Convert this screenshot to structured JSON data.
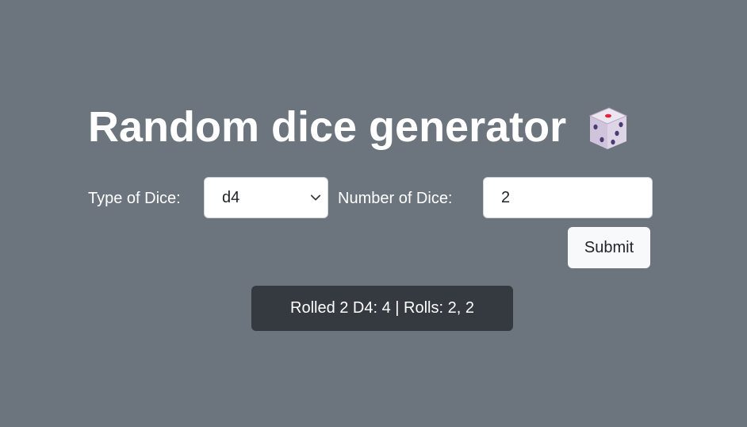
{
  "header": {
    "title": "Random dice generator",
    "icon": "game-die-icon"
  },
  "form": {
    "type_label": "Type of Dice:",
    "type_selected": "d4",
    "number_label": "Number of Dice:",
    "number_value": "2",
    "submit_label": "Submit"
  },
  "result": {
    "text": "Rolled 2 D4: 4 | Rolls: 2, 2"
  },
  "colors": {
    "background": "#6c757d",
    "result_background": "#343a40",
    "button_background": "#f8f9fa",
    "die_pip_red": "#e0243a",
    "die_pip_purple": "#4b3a73"
  }
}
